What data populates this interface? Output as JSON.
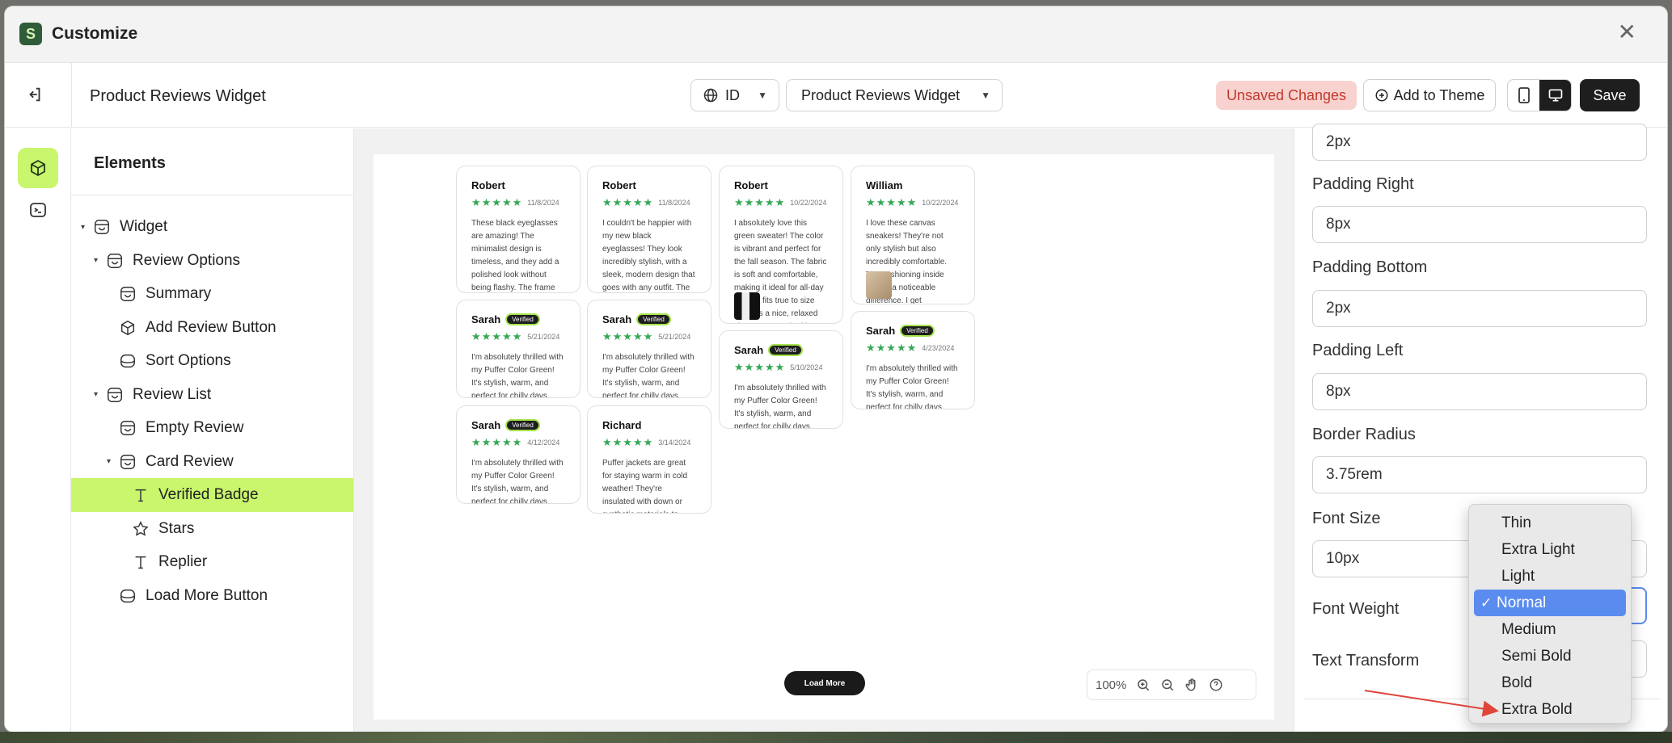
{
  "app": {
    "title": "Customize",
    "close_icon": "close-icon"
  },
  "toolbar": {
    "widget_title": "Product Reviews Widget",
    "language": "ID",
    "widget_select": "Product Reviews Widget",
    "unsaved_label": "Unsaved Changes",
    "add_to_theme_label": "Add to Theme",
    "save_label": "Save"
  },
  "elements_panel": {
    "title": "Elements",
    "tree": [
      {
        "label": "Widget",
        "icon": "smiley-box-icon",
        "level": 0,
        "caret": true
      },
      {
        "label": "Review Options",
        "icon": "smiley-box-icon",
        "level": 1,
        "caret": true
      },
      {
        "label": "Summary",
        "icon": "smiley-box-icon",
        "level": 2,
        "caret": false
      },
      {
        "label": "Add Review Button",
        "icon": "cube-icon",
        "level": 2,
        "caret": false
      },
      {
        "label": "Sort Options",
        "icon": "box-icon",
        "level": 2,
        "caret": false
      },
      {
        "label": "Review List",
        "icon": "smiley-box-icon",
        "level": 1,
        "caret": true
      },
      {
        "label": "Empty Review",
        "icon": "smiley-box-icon",
        "level": 2,
        "caret": false
      },
      {
        "label": "Card Review",
        "icon": "smiley-box-icon",
        "level": 2,
        "caret": true
      },
      {
        "label": "Verified Badge",
        "icon": "text-icon",
        "level": 3,
        "caret": false,
        "selected": true
      },
      {
        "label": "Stars",
        "icon": "star-icon",
        "level": 3,
        "caret": false
      },
      {
        "label": "Replier",
        "icon": "text-icon",
        "level": 3,
        "caret": false
      },
      {
        "label": "Load More Button",
        "icon": "box-icon",
        "level": 2,
        "caret": false
      }
    ]
  },
  "preview": {
    "reviews": [
      {
        "name": "Robert",
        "verified": false,
        "stars": "★★★★★",
        "date": "11/8/2024",
        "text": "These black eyeglasses are amazing! The minimalist design is timeless, and they add a polished look without being flashy. The frame fits perfectly—not too tight, not too loose—and they're super comfortable, even after wearing them for hours. The qual..."
      },
      {
        "name": "Robert",
        "verified": false,
        "stars": "★★★★★",
        "date": "11/8/2024",
        "text": "I couldn't be happier with my new black eyeglasses! They look incredibly stylish, with a sleek, modern design that goes with any outfit. The frame feels sturdy but lightweight, so they're comfortable to wear all day. The lenses offer clear vision wit..."
      },
      {
        "name": "Robert",
        "verified": false,
        "stars": "★★★★★",
        "date": "10/22/2024",
        "text": "I absolutely love this green sweater! The color is vibrant and perfect for the fall season. The fabric is soft and comfortable, making it ideal for all-day wear. It fits true to size and has a nice, relaxed shape. I've washed it a few times, and it h..."
      },
      {
        "name": "William",
        "verified": false,
        "stars": "★★★★★",
        "date": "10/22/2024",
        "text": "I love these canvas sneakers! They're not only stylish but also incredibly comfortable. The cushioning inside makes a noticeable difference. I get compliments on them all the time."
      },
      {
        "name": "Sarah",
        "verified": true,
        "stars": "★★★★★",
        "date": "5/21/2024",
        "text": "I'm absolutely thrilled with my Puffer Color Green! It's stylish, warm, and perfect for chilly days. The color is vibrant and eye-catching. Highly recommend!"
      },
      {
        "name": "Sarah",
        "verified": true,
        "stars": "★★★★★",
        "date": "5/21/2024",
        "text": "I'm absolutely thrilled with my Puffer Color Green! It's stylish, warm, and perfect for chilly days. The color is vibrant and eye-catching. Highly recommend!"
      },
      {
        "name": "Sarah",
        "verified": true,
        "stars": "★★★★★",
        "date": "5/10/2024",
        "text": "I'm absolutely thrilled with my Puffer Color Green! It's stylish, warm, and perfect for chilly days. The color is vibrant and eye-catching. Highly recommend!"
      },
      {
        "name": "Sarah",
        "verified": true,
        "stars": "★★★★★",
        "date": "4/23/2024",
        "text": "I'm absolutely thrilled with my Puffer Color Green! It's stylish, warm, and perfect for chilly days. The color is vibrant and eye-catching. Highly recommend!"
      },
      {
        "name": "Sarah",
        "verified": true,
        "stars": "★★★★★",
        "date": "4/12/2024",
        "text": "I'm absolutely thrilled with my Puffer Color Green! It's stylish, warm, and perfect for chilly days. The color is vibrant and eye-catching. Highly recommend!"
      },
      {
        "name": "Richard",
        "verified": false,
        "stars": "★★★★★",
        "date": "3/14/2024",
        "text": "Puffer jackets are great for staying warm in cold weather! They're insulated with down or synthetic materials to provide warmth and are often lightweight and comfortable to wear"
      }
    ],
    "verified_label": "Verified",
    "load_more_label": "Load More",
    "zoom_level": "100%"
  },
  "properties": {
    "padding_top_value": "2px",
    "padding_right_label": "Padding Right",
    "padding_right_value": "8px",
    "padding_bottom_label": "Padding Bottom",
    "padding_bottom_value": "2px",
    "padding_left_label": "Padding Left",
    "padding_left_value": "8px",
    "border_radius_label": "Border Radius",
    "border_radius_value": "3.75rem",
    "font_size_label": "Font Size",
    "font_size_value": "10px",
    "font_weight_label": "Font Weight",
    "text_transform_label": "Text Transform"
  },
  "font_weight_dropdown": {
    "options": [
      "Thin",
      "Extra Light",
      "Light",
      "Normal",
      "Medium",
      "Semi Bold",
      "Bold",
      "Extra Bold"
    ],
    "selected": "Normal"
  },
  "colors": {
    "accent_green": "#c9f66d",
    "unsaved_bg": "#f8d2cf",
    "unsaved_text": "#c0392b",
    "star_green": "#34a853",
    "dropdown_selected": "#5a8cf0",
    "annotation_arrow": "#e0453a"
  }
}
